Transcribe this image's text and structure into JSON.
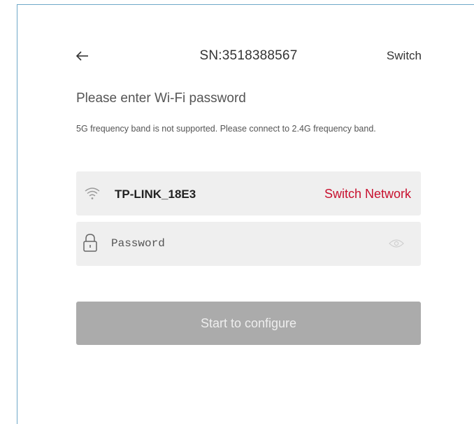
{
  "header": {
    "back_icon": "arrow-left-icon",
    "title": "SN:3518388567",
    "switch_label": "Switch"
  },
  "heading": "Please enter Wi-Fi password",
  "note": "5G frequency band is not supported. Please connect to 2.4G frequency band.",
  "network": {
    "icon": "wifi-icon",
    "name": "TP-LINK_18E3",
    "switch_label": "Switch Network",
    "switch_color": "#c8102e"
  },
  "password": {
    "icon": "lock-icon",
    "value": "",
    "placeholder": "Password",
    "toggle_icon": "eye-icon"
  },
  "submit": {
    "label": "Start to configure",
    "color": "#ababab"
  }
}
